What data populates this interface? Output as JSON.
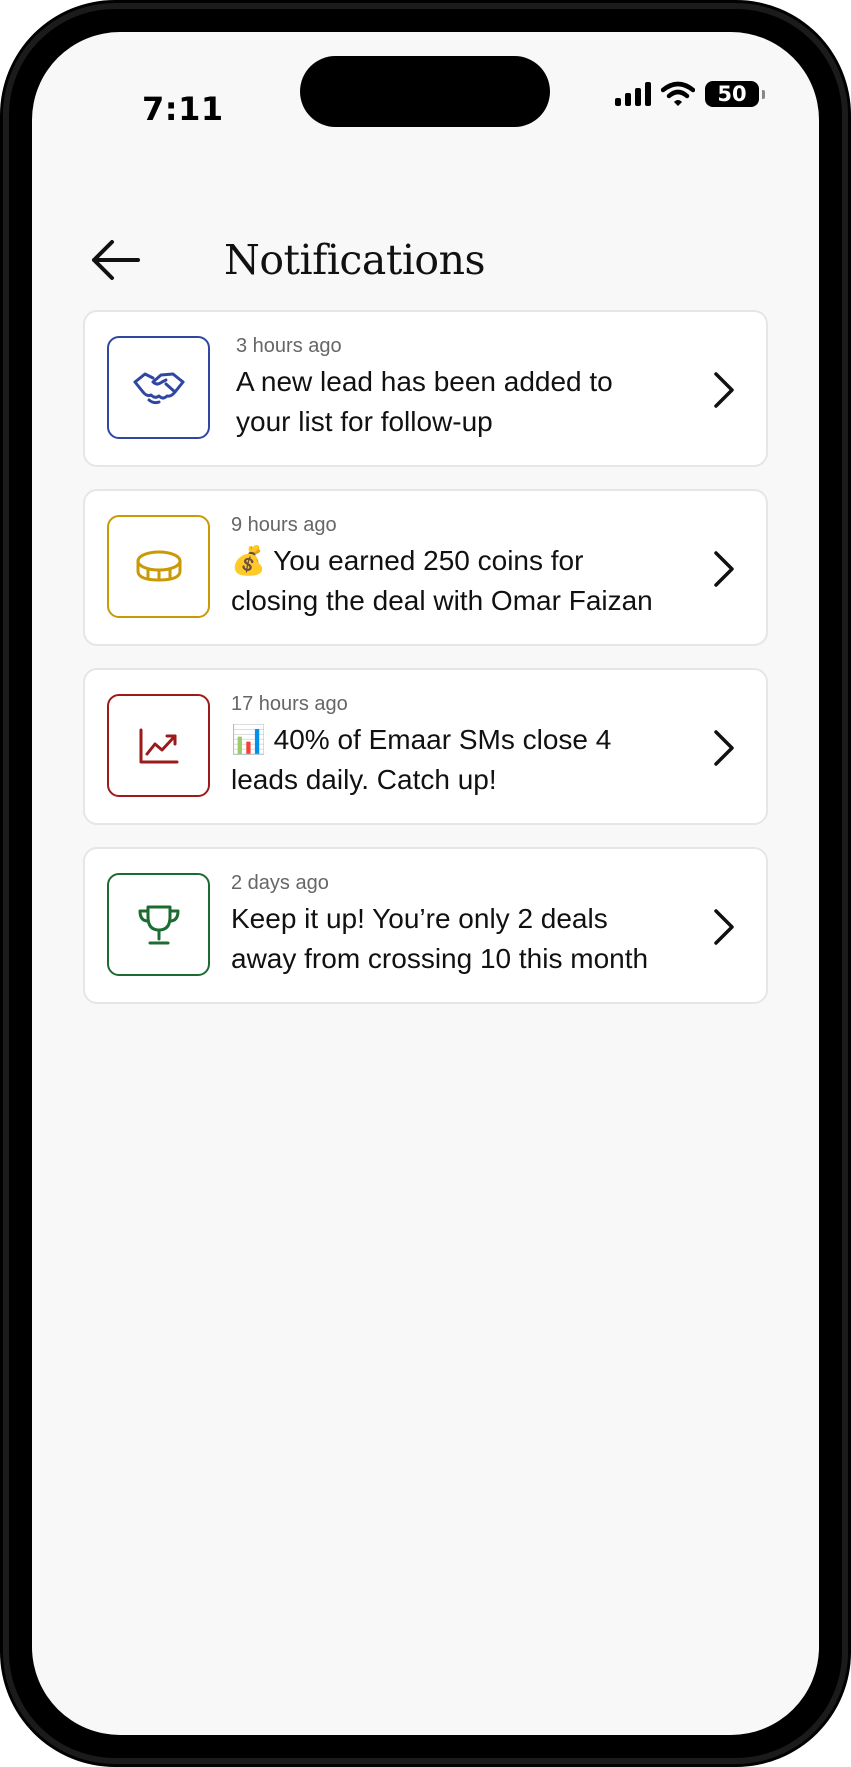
{
  "status_bar": {
    "time": "7:11",
    "battery": "50"
  },
  "header": {
    "title": "Notifications"
  },
  "notifications": [
    {
      "time": "3 hours ago",
      "text": "A new lead has been added to your list for follow-up",
      "icon": "handshake-icon",
      "color": "#2F47A1"
    },
    {
      "time": "9 hours ago",
      "text": "💰 You earned 250 coins for closing the deal with Omar Faizan",
      "icon": "coin-icon",
      "color": "#C99A06"
    },
    {
      "time": "17 hours ago",
      "text": "📊 40% of Emaar SMs close 4 leads daily. Catch up!",
      "icon": "chart-up-icon",
      "color": "#9B1B1B"
    },
    {
      "time": "2 days ago",
      "text": "Keep it up! You’re only 2 deals away from crossing 10 this month",
      "icon": "trophy-icon",
      "color": "#1C6B32"
    }
  ]
}
